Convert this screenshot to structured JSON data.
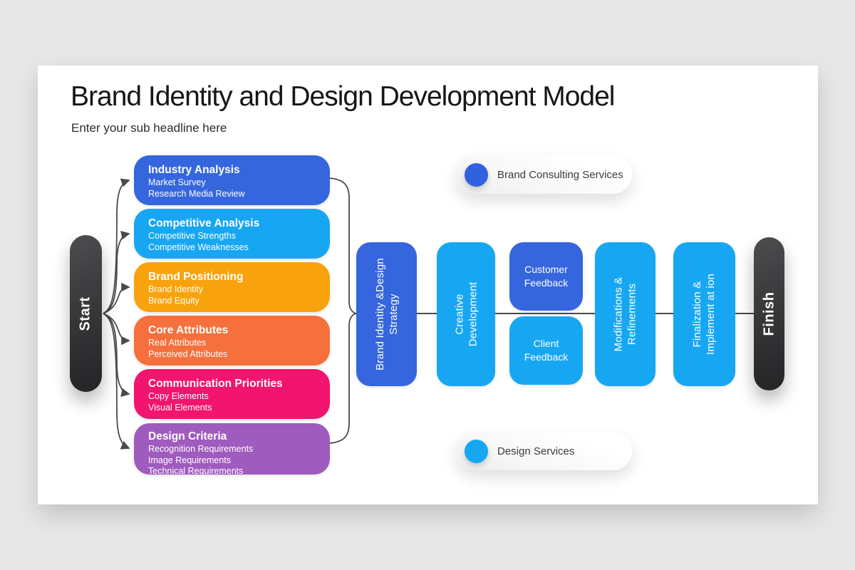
{
  "header": {
    "title": "Brand Identity and Design Development Model",
    "subtitle": "Enter your sub headline here"
  },
  "endpoints": {
    "start": "Start",
    "finish": "Finish"
  },
  "phases": [
    {
      "title": "Industry Analysis",
      "lines": [
        "Market Survey",
        "Research Media Review"
      ],
      "color": "#3666DE"
    },
    {
      "title": "Competitive Analysis",
      "lines": [
        "Competitive Strengths",
        "Competitive Weaknesses"
      ],
      "color": "#17A7F2"
    },
    {
      "title": "Brand Positioning",
      "lines": [
        "Brand Identity",
        "Brand Equity"
      ],
      "color": "#F8A30D"
    },
    {
      "title": "Core Attributes",
      "lines": [
        "Real Attributes",
        "Perceived Attributes"
      ],
      "color": "#F5703C"
    },
    {
      "title": "Communication Priorities",
      "lines": [
        "Copy Elements",
        "Visual Elements"
      ],
      "color": "#F2146E"
    },
    {
      "title": "Design Criteria",
      "lines": [
        "Recognition Requirements",
        "Image Requirements",
        "Technical Requirements"
      ],
      "color": "#A05BBE"
    }
  ],
  "flow": {
    "strategy": {
      "lines": [
        "Brand Identity &Design",
        "Strategy"
      ],
      "color": "#3666DE"
    },
    "creative": {
      "lines": [
        "Creative",
        "Development"
      ],
      "color": "#17A7F2"
    },
    "customer": {
      "lines": [
        "Customer",
        "Feedback"
      ],
      "color": "#3666DE"
    },
    "client": {
      "lines": [
        "Client",
        "Feedback"
      ],
      "color": "#17A7F2"
    },
    "modifications": {
      "lines": [
        "Modifications &",
        "Refinements"
      ],
      "color": "#17A7F2"
    },
    "finalization": {
      "lines": [
        "Finalization &",
        "Implement at ion"
      ],
      "color": "#17A7F2"
    }
  },
  "legend": [
    {
      "label": "Brand Consulting Services",
      "color": "#3161DE"
    },
    {
      "label": "Design Services",
      "color": "#17A7F2"
    }
  ],
  "colors": {
    "page_background": "#E8E7E7",
    "slide_background": "#FFFFFF",
    "start_finish": "#39393B",
    "connector": "#4A4A4A",
    "royal_blue": "#3666DE",
    "light_blue": "#17A7F2",
    "amber": "#F8A30D",
    "orange": "#F5703C",
    "pink": "#F2146E",
    "purple": "#A05BBE"
  }
}
